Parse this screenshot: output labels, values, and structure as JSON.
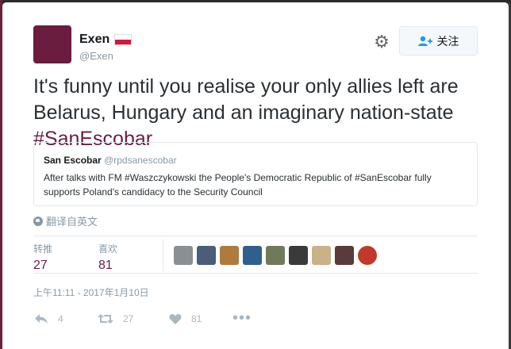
{
  "author": {
    "name": "Exen",
    "handle": "@Exen",
    "flag_icon": "poland-flag-icon",
    "avatar_color": "#6a1d3f"
  },
  "header": {
    "settings_icon": "gear-icon",
    "follow_label": "关注"
  },
  "tweet": {
    "text_before": "It's funny until you realise your only allies left are Belarus, Hungary and an imaginary nation-state ",
    "hashtag": "#SanEscobar"
  },
  "quote": {
    "name": "San Escobar",
    "handle": "@rpdsanescobar",
    "text": "After talks with FM #Waszczykowski the People's Democratic Republic of #SanEscobar fully supports Poland's candidacy to the Security Council"
  },
  "translate_label": "翻译自英文",
  "stats": {
    "retweets_label": "转推",
    "retweets": "27",
    "likes_label": "喜欢",
    "likes": "81",
    "liker_avatar_colors": [
      "#8a8f96",
      "#4a5d7a",
      "#b07a3c",
      "#2f5f8f",
      "#6f7a5a",
      "#3a3a3a",
      "#c9b28a",
      "#5a3a3a",
      "#c0392b"
    ]
  },
  "timestamp": "上午11:11 - 2017年1月10日",
  "actions": {
    "replies": "4",
    "retweets": "27",
    "likes": "81"
  },
  "colors": {
    "accent": "#6a1d3f",
    "muted": "#8899a6"
  }
}
